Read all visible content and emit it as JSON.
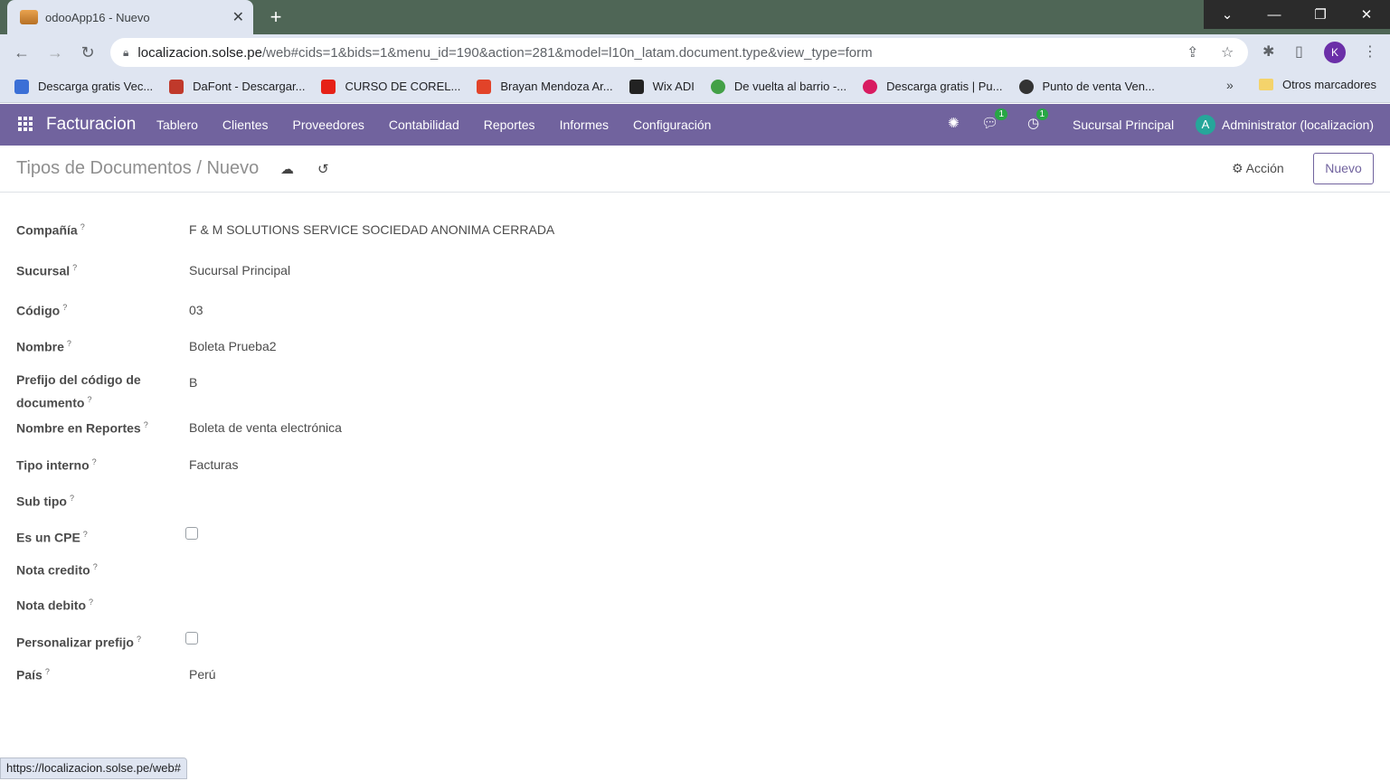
{
  "browser": {
    "tab_title": "odooApp16 - Nuevo",
    "tab_close": "✕",
    "new_tab": "+",
    "url_host": "localizacion.solse.pe",
    "url_path": "/web#cids=1&bids=1&menu_id=190&action=281&model=l10n_latam.document.type&view_type=form",
    "profile_initial": "K",
    "bookmarks": [
      {
        "label": "Descarga gratis Vec...",
        "color": "#3b6fd6"
      },
      {
        "label": "DaFont - Descargar...",
        "color": "#c0392b"
      },
      {
        "label": "CURSO DE COREL...",
        "color": "#e62117"
      },
      {
        "label": "Brayan Mendoza Ar...",
        "color": "#e24329"
      },
      {
        "label": "Wix ADI",
        "color": "#222222"
      },
      {
        "label": "De vuelta al barrio -...",
        "color": "#43a047"
      },
      {
        "label": "Descarga gratis | Pu...",
        "color": "#d81b60"
      },
      {
        "label": "Punto de venta Ven...",
        "color": "#333333"
      }
    ],
    "bookmarks_more": "»",
    "other_bookmarks": "Otros marcadores",
    "status_url": "https://localizacion.solse.pe/web#"
  },
  "navbar": {
    "brand": "Facturacion",
    "menu": [
      "Tablero",
      "Clientes",
      "Proveedores",
      "Contabilidad",
      "Reportes",
      "Informes",
      "Configuración"
    ],
    "messages_count": "1",
    "activities_count": "1",
    "branch": "Sucursal Principal",
    "avatar_initial": "A",
    "user": "Administrator (localizacion)"
  },
  "control_panel": {
    "breadcrumb": "Tipos de Documentos / Nuevo",
    "action_label": "⚙ Acción",
    "new_label": "Nuevo"
  },
  "form": {
    "fields": [
      {
        "label": "Compañía",
        "value": "F & M SOLUTIONS SERVICE SOCIEDAD ANONIMA CERRADA"
      },
      {
        "label": "Sucursal",
        "value": "Sucursal Principal"
      },
      {
        "label": "Código",
        "value": "03"
      },
      {
        "label": "Nombre",
        "value": "Boleta Prueba2"
      },
      {
        "label": "Prefijo del código de documento",
        "value": "B"
      },
      {
        "label": "Nombre en Reportes",
        "value": "Boleta de venta electrónica"
      },
      {
        "label": "Tipo interno",
        "value": "Facturas"
      },
      {
        "label": "Sub tipo",
        "value": ""
      },
      {
        "label": "Es un CPE",
        "checked": false
      },
      {
        "label": "Nota credito",
        "value": ""
      },
      {
        "label": "Nota debito",
        "value": ""
      },
      {
        "label": "Personalizar prefijo",
        "checked": false
      },
      {
        "label": "País",
        "value": "Perú"
      }
    ],
    "help_mark": "?"
  }
}
